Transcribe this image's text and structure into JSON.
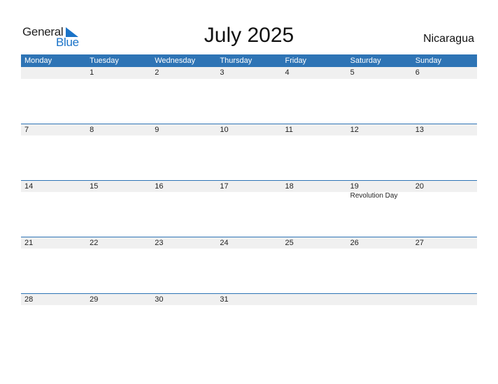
{
  "logo": {
    "general": "General",
    "blue": "Blue",
    "accent": "#1a73c8"
  },
  "title": "July 2025",
  "country": "Nicaragua",
  "colors": {
    "header_bg": "#2e74b5",
    "date_row_bg": "#f0f0f0"
  },
  "weekdays": [
    "Monday",
    "Tuesday",
    "Wednesday",
    "Thursday",
    "Friday",
    "Saturday",
    "Sunday"
  ],
  "weeks": [
    {
      "days": [
        "",
        "1",
        "2",
        "3",
        "4",
        "5",
        "6"
      ],
      "events": [
        "",
        "",
        "",
        "",
        "",
        "",
        ""
      ]
    },
    {
      "days": [
        "7",
        "8",
        "9",
        "10",
        "11",
        "12",
        "13"
      ],
      "events": [
        "",
        "",
        "",
        "",
        "",
        "",
        ""
      ]
    },
    {
      "days": [
        "14",
        "15",
        "16",
        "17",
        "18",
        "19",
        "20"
      ],
      "events": [
        "",
        "",
        "",
        "",
        "",
        "Revolution Day",
        ""
      ]
    },
    {
      "days": [
        "21",
        "22",
        "23",
        "24",
        "25",
        "26",
        "27"
      ],
      "events": [
        "",
        "",
        "",
        "",
        "",
        "",
        ""
      ]
    },
    {
      "days": [
        "28",
        "29",
        "30",
        "31",
        "",
        "",
        ""
      ],
      "events": [
        "",
        "",
        "",
        "",
        "",
        "",
        ""
      ]
    }
  ]
}
